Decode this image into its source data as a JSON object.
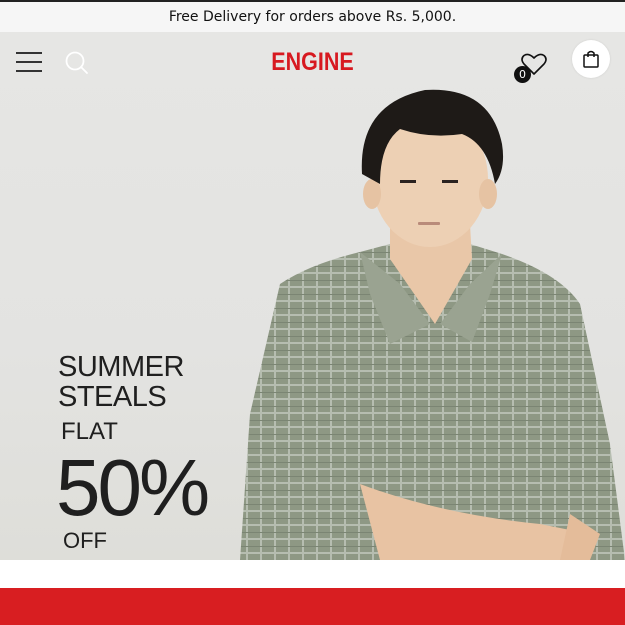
{
  "announcement": {
    "text": "Free Delivery for orders above Rs. 5,000."
  },
  "header": {
    "logo": "ENGINE",
    "wishlist_count": "0",
    "icons": [
      "menu-icon",
      "search-icon",
      "heart-icon",
      "shopping-bag-icon"
    ]
  },
  "hero": {
    "line1": "SUMMER",
    "line2": "STEALS",
    "flat": "FLAT",
    "percent": "50%",
    "off": "OFF"
  },
  "colors": {
    "brand": "#d71920",
    "banner_band": "#d81e21",
    "hero_bg": "#e4e4e2",
    "announcement_bg": "#f6f6f6"
  }
}
